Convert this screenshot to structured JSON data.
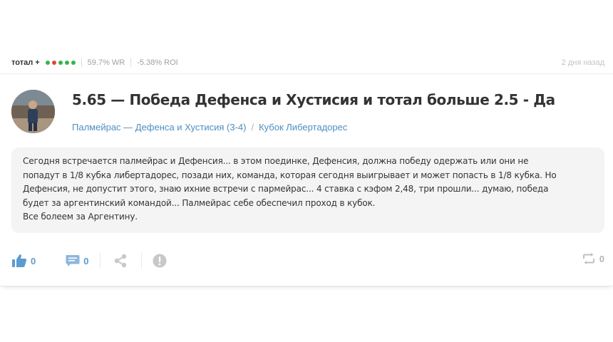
{
  "author": {
    "name": "тотал +",
    "form_dots": [
      "#38b44a",
      "#e0463e",
      "#38b44a",
      "#38b44a",
      "#38b44a"
    ]
  },
  "stats": {
    "winrate": "59.7% WR",
    "roi": "-5.38% ROI"
  },
  "posted_ago": "2 дня назад",
  "tip": {
    "title": "5.65 — Победа Дефенса и Хустисия и тотал больше 2.5 - Да",
    "match_link": "Палмейрас — Дефенса и Хустисия (3-4)",
    "separator": "/",
    "tournament_link": "Кубок Либертадорес",
    "text_lines": [
      "Сегодня встречается палмейрас и Дефенсия... в этом поединке, Дефенсия, должна победу одержать или они не",
      "попадут в 1/8 кубка либертадорес, позади них, команда, которая сегодня выигрывает и может попасть в 1/8 кубка. Но",
      "Дефенсия, не допустит этого, знаю ихние встречи с пармейрас... 4 ставка с кэфом 2,48, три прошли... думаю, победа",
      "будет за аргентинский командой... Палмейрас себе обеспечил проход в кубок.",
      "Все болеем за Аргентину."
    ]
  },
  "actions": {
    "likes": "0",
    "comments": "0",
    "reposts": "0"
  },
  "colors": {
    "accent": "#5b9bd1",
    "link": "#4d8ec1",
    "icon_muted": "#c8c8c8"
  }
}
